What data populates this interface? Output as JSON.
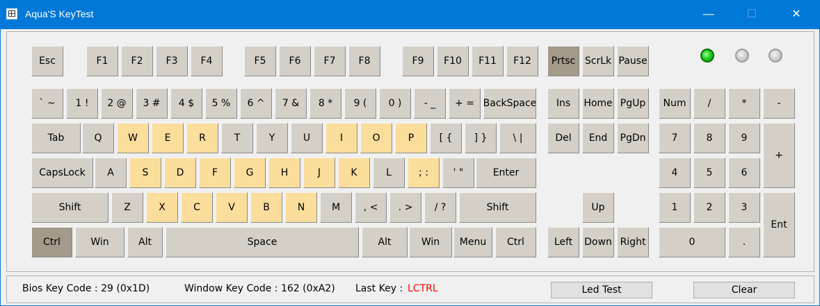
{
  "window": {
    "title": "Aqua'S KeyTest",
    "minimize_glyph": "—",
    "maximize_glyph": "☐",
    "close_glyph": "✕"
  },
  "leds": [
    {
      "name": "num-lock",
      "state": "on"
    },
    {
      "name": "caps-lock",
      "state": "off"
    },
    {
      "name": "scroll-lock",
      "state": "off"
    }
  ],
  "keys": [
    {
      "id": "esc",
      "label": "Esc",
      "row": 0
    },
    {
      "id": "f1",
      "label": "F1",
      "row": 0
    },
    {
      "id": "f2",
      "label": "F2",
      "row": 0
    },
    {
      "id": "f3",
      "label": "F3",
      "row": 0
    },
    {
      "id": "f4",
      "label": "F4",
      "row": 0
    },
    {
      "id": "f5",
      "label": "F5",
      "row": 0
    },
    {
      "id": "f6",
      "label": "F6",
      "row": 0
    },
    {
      "id": "f7",
      "label": "F7",
      "row": 0
    },
    {
      "id": "f8",
      "label": "F8",
      "row": 0
    },
    {
      "id": "f9",
      "label": "F9",
      "row": 0
    },
    {
      "id": "f10",
      "label": "F10",
      "row": 0
    },
    {
      "id": "f11",
      "label": "F11",
      "row": 0
    },
    {
      "id": "f12",
      "label": "F12",
      "row": 0
    },
    {
      "id": "prtsc",
      "label": "Prtsc",
      "row": 0,
      "state": "active"
    },
    {
      "id": "scrlk",
      "label": "ScrLk",
      "row": 0
    },
    {
      "id": "pause",
      "label": "Pause",
      "row": 0
    },
    {
      "id": "backquote",
      "label": "` ~",
      "row": 1
    },
    {
      "id": "digit1",
      "label": "1 !",
      "row": 1
    },
    {
      "id": "digit2",
      "label": "2 @",
      "row": 1
    },
    {
      "id": "digit3",
      "label": "3 #",
      "row": 1
    },
    {
      "id": "digit4",
      "label": "4 $",
      "row": 1
    },
    {
      "id": "digit5",
      "label": "5 %",
      "row": 1
    },
    {
      "id": "digit6",
      "label": "6 ^",
      "row": 1
    },
    {
      "id": "digit7",
      "label": "7 &",
      "row": 1
    },
    {
      "id": "digit8",
      "label": "8 *",
      "row": 1
    },
    {
      "id": "digit9",
      "label": "9 (",
      "row": 1
    },
    {
      "id": "digit0",
      "label": "0 )",
      "row": 1
    },
    {
      "id": "minus",
      "label": "- _",
      "row": 1
    },
    {
      "id": "equal",
      "label": "+ =",
      "row": 1
    },
    {
      "id": "backspace",
      "label": "BackSpace",
      "row": 1
    },
    {
      "id": "ins",
      "label": "Ins",
      "row": 1
    },
    {
      "id": "home",
      "label": "Home",
      "row": 1
    },
    {
      "id": "pgup",
      "label": "PgUp",
      "row": 1
    },
    {
      "id": "numlock",
      "label": "Num",
      "row": 1
    },
    {
      "id": "num-div",
      "label": "/",
      "row": 1
    },
    {
      "id": "num-mul",
      "label": "*",
      "row": 1
    },
    {
      "id": "num-sub",
      "label": "-",
      "row": 1
    },
    {
      "id": "tab",
      "label": "Tab",
      "row": 2
    },
    {
      "id": "q",
      "label": "Q",
      "row": 2
    },
    {
      "id": "w",
      "label": "W",
      "row": 2,
      "state": "tested"
    },
    {
      "id": "e",
      "label": "E",
      "row": 2,
      "state": "tested"
    },
    {
      "id": "r",
      "label": "R",
      "row": 2,
      "state": "tested"
    },
    {
      "id": "t",
      "label": "T",
      "row": 2
    },
    {
      "id": "y",
      "label": "Y",
      "row": 2
    },
    {
      "id": "u",
      "label": "U",
      "row": 2
    },
    {
      "id": "i",
      "label": "I",
      "row": 2,
      "state": "tested"
    },
    {
      "id": "o",
      "label": "O",
      "row": 2,
      "state": "tested"
    },
    {
      "id": "p",
      "label": "P",
      "row": 2,
      "state": "tested"
    },
    {
      "id": "bracketleft",
      "label": "[ {",
      "row": 2
    },
    {
      "id": "bracketright",
      "label": "] }",
      "row": 2
    },
    {
      "id": "backslash",
      "label": "\\ |",
      "row": 2
    },
    {
      "id": "del",
      "label": "Del",
      "row": 2
    },
    {
      "id": "end",
      "label": "End",
      "row": 2
    },
    {
      "id": "pgdn",
      "label": "PgDn",
      "row": 2
    },
    {
      "id": "num7",
      "label": "7",
      "row": 2
    },
    {
      "id": "num8",
      "label": "8",
      "row": 2
    },
    {
      "id": "num9",
      "label": "9",
      "row": 2
    },
    {
      "id": "num-add",
      "label": "+",
      "row": 2
    },
    {
      "id": "capslock",
      "label": "CapsLock",
      "row": 3
    },
    {
      "id": "a",
      "label": "A",
      "row": 3
    },
    {
      "id": "s",
      "label": "S",
      "row": 3,
      "state": "tested"
    },
    {
      "id": "d",
      "label": "D",
      "row": 3,
      "state": "tested"
    },
    {
      "id": "f",
      "label": "F",
      "row": 3,
      "state": "tested"
    },
    {
      "id": "g",
      "label": "G",
      "row": 3,
      "state": "tested"
    },
    {
      "id": "h",
      "label": "H",
      "row": 3,
      "state": "tested"
    },
    {
      "id": "j",
      "label": "J",
      "row": 3,
      "state": "tested"
    },
    {
      "id": "k",
      "label": "K",
      "row": 3,
      "state": "tested"
    },
    {
      "id": "l",
      "label": "L",
      "row": 3
    },
    {
      "id": "semicolon",
      "label": "; :",
      "row": 3,
      "state": "tested"
    },
    {
      "id": "quote",
      "label": "' \"",
      "row": 3
    },
    {
      "id": "enter",
      "label": "Enter",
      "row": 3
    },
    {
      "id": "num4",
      "label": "4",
      "row": 3
    },
    {
      "id": "num5",
      "label": "5",
      "row": 3
    },
    {
      "id": "num6",
      "label": "6",
      "row": 3
    },
    {
      "id": "shift-left",
      "label": "Shift",
      "row": 4
    },
    {
      "id": "z",
      "label": "Z",
      "row": 4
    },
    {
      "id": "x",
      "label": "X",
      "row": 4,
      "state": "tested"
    },
    {
      "id": "c",
      "label": "C",
      "row": 4,
      "state": "tested"
    },
    {
      "id": "v",
      "label": "V",
      "row": 4,
      "state": "tested"
    },
    {
      "id": "b",
      "label": "B",
      "row": 4,
      "state": "tested"
    },
    {
      "id": "n",
      "label": "N",
      "row": 4,
      "state": "tested"
    },
    {
      "id": "m",
      "label": "M",
      "row": 4
    },
    {
      "id": "comma",
      "label": ", <",
      "row": 4
    },
    {
      "id": "period",
      "label": ". >",
      "row": 4
    },
    {
      "id": "slash",
      "label": "/ ?",
      "row": 4
    },
    {
      "id": "shift-right",
      "label": "Shift",
      "row": 4
    },
    {
      "id": "up",
      "label": "Up",
      "row": 4
    },
    {
      "id": "num1",
      "label": "1",
      "row": 4
    },
    {
      "id": "num2",
      "label": "2",
      "row": 4
    },
    {
      "id": "num3",
      "label": "3",
      "row": 4
    },
    {
      "id": "num-enter",
      "label": "Ent",
      "row": 4
    },
    {
      "id": "ctrl-left",
      "label": "Ctrl",
      "row": 5,
      "state": "active"
    },
    {
      "id": "win-left",
      "label": "Win",
      "row": 5
    },
    {
      "id": "alt-left",
      "label": "Alt",
      "row": 5
    },
    {
      "id": "space",
      "label": "Space",
      "row": 5
    },
    {
      "id": "alt-right",
      "label": "Alt",
      "row": 5
    },
    {
      "id": "win-right",
      "label": "Win",
      "row": 5
    },
    {
      "id": "menu",
      "label": "Menu",
      "row": 5
    },
    {
      "id": "ctrl-right",
      "label": "Ctrl",
      "row": 5
    },
    {
      "id": "left",
      "label": "Left",
      "row": 5
    },
    {
      "id": "down",
      "label": "Down",
      "row": 5
    },
    {
      "id": "right",
      "label": "Right",
      "row": 5
    },
    {
      "id": "num0",
      "label": "0",
      "row": 5
    },
    {
      "id": "num-dec",
      "label": ".",
      "row": 5
    }
  ],
  "status": {
    "bios_label": "Bios Key Code : 29 (0x1D)",
    "window_label": "Window Key Code : 162 (0xA2)",
    "lastkey_label": "Last Key :",
    "lastkey_value": "LCTRL",
    "led_test_button": "Led Test",
    "clear_button": "Clear"
  },
  "colors": {
    "tested": "#fbdd9c",
    "active": "#a39a8c",
    "key": "#d4d0c8",
    "titlebar": "#0078d7",
    "lastkey": "#ff0000"
  }
}
